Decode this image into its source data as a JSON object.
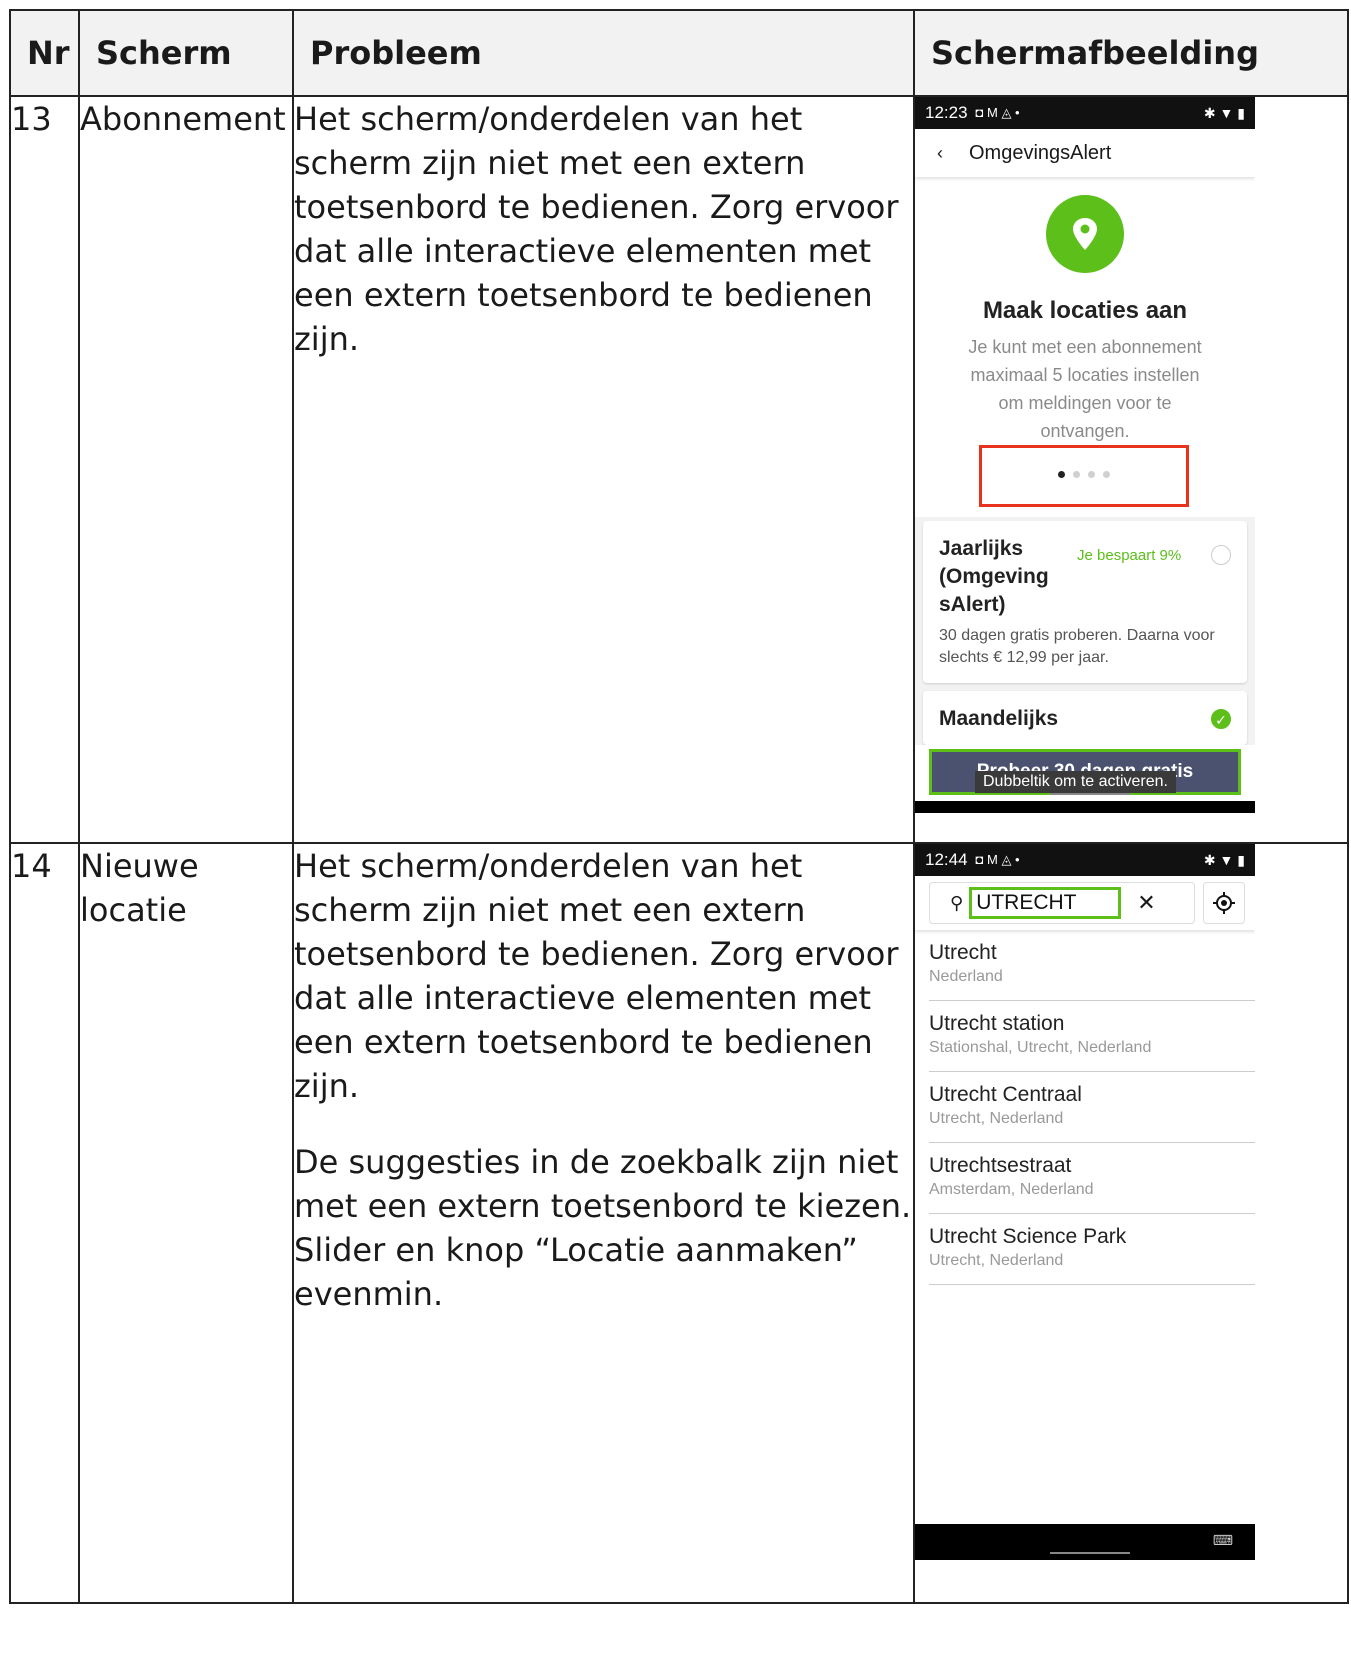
{
  "headers": {
    "nr": "Nr",
    "scherm": "Scherm",
    "probleem": "Probleem",
    "screenshot": "Schermafbeelding"
  },
  "rows": [
    {
      "nr": "13",
      "scherm": "Abonnement",
      "problems": [
        "Het scherm/onderdelen van het scherm zijn niet met een extern toetsenbord te bedienen. Zorg ervoor dat alle interactieve elementen met een extern toetsenbord te bedienen zijn."
      ],
      "screenshot": {
        "status_time": "12:23",
        "status_icons": "◘ M ◬ •",
        "status_right": "✱ ▼ ▮",
        "appbar_title": "OmgevingsAlert",
        "intro_title": "Maak locaties aan",
        "intro_body": "Je kunt met een abonnement maximaal 5 locaties instellen om meldingen voor te ontvangen.",
        "plans": [
          {
            "title": "Jaarlijks (Omgeving sAlert)",
            "badge": "Je bespaart 9%",
            "desc": "30 dagen gratis proberen. Daarna voor slechts € 12,99 per jaar.",
            "selected": false
          },
          {
            "title": "Maandelijks",
            "badge": "",
            "desc": "",
            "selected": true
          }
        ],
        "cta_label": "Probeer 30 dagen gratis",
        "tooltip": "Dubbeltik om te activeren.",
        "carousel_active_index": 0,
        "carousel_count": 4,
        "accent_color": "#5cbf1a",
        "highlight_color": "#e8321e"
      }
    },
    {
      "nr": "14",
      "scherm": "Nieuwe locatie",
      "problems": [
        "Het scherm/onderdelen van het scherm zijn niet met een extern toetsenbord te bedienen. Zorg ervoor dat alle interactieve elementen met een extern toetsenbord te bedienen zijn.",
        "De suggesties in de zoekbalk zijn niet met een extern toetsenbord te kiezen. Slider en knop “Locatie aanmaken” evenmin."
      ],
      "screenshot": {
        "status_time": "12:44",
        "status_icons": "◘ M ◬ •",
        "status_right": "✱ ▼ ▮",
        "search_value": "UTRECHT",
        "suggestions": [
          {
            "title": "Utrecht",
            "subtitle": "Nederland"
          },
          {
            "title": "Utrecht station",
            "subtitle": "Stationshal, Utrecht, Nederland"
          },
          {
            "title": "Utrecht Centraal",
            "subtitle": "Utrecht, Nederland"
          },
          {
            "title": "Utrechtsestraat",
            "subtitle": "Amsterdam, Nederland"
          },
          {
            "title": "Utrecht Science Park",
            "subtitle": "Utrecht, Nederland"
          }
        ]
      }
    }
  ]
}
